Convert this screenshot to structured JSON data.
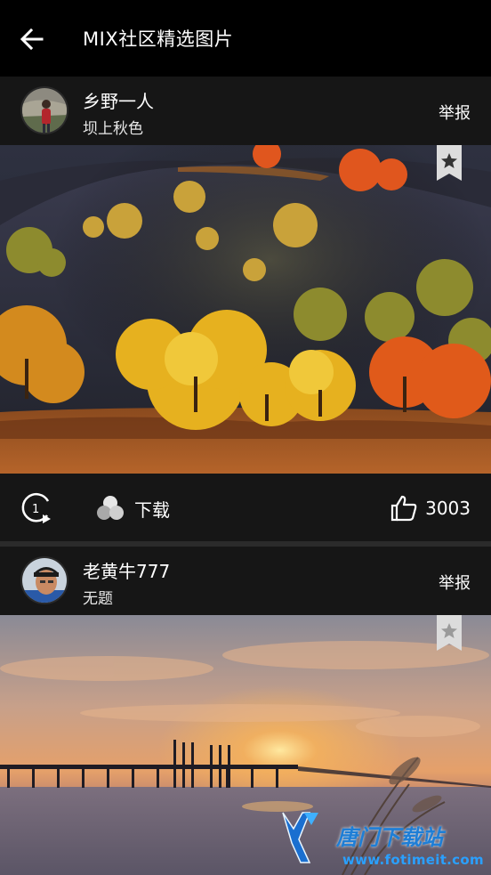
{
  "header": {
    "title": "MIX社区精选图片",
    "back_icon": "arrow-left-icon"
  },
  "posts": [
    {
      "username": "乡野一人",
      "subtitle": "坝上秋色",
      "report_label": "举报",
      "download_label": "下载",
      "like_count": "3003",
      "icons": [
        "replay-icon",
        "download-icon",
        "thumbs-up-icon",
        "star-bookmark-icon"
      ]
    },
    {
      "username": "老黄牛777",
      "subtitle": "无题",
      "report_label": "举报",
      "watermark": {
        "text": "唐门下载站",
        "url": "www.fotimeit.com"
      }
    }
  ],
  "colors": {
    "background": "#000000",
    "card": "#161616",
    "divider": "#2b2b2b",
    "text": "#ffffff"
  }
}
